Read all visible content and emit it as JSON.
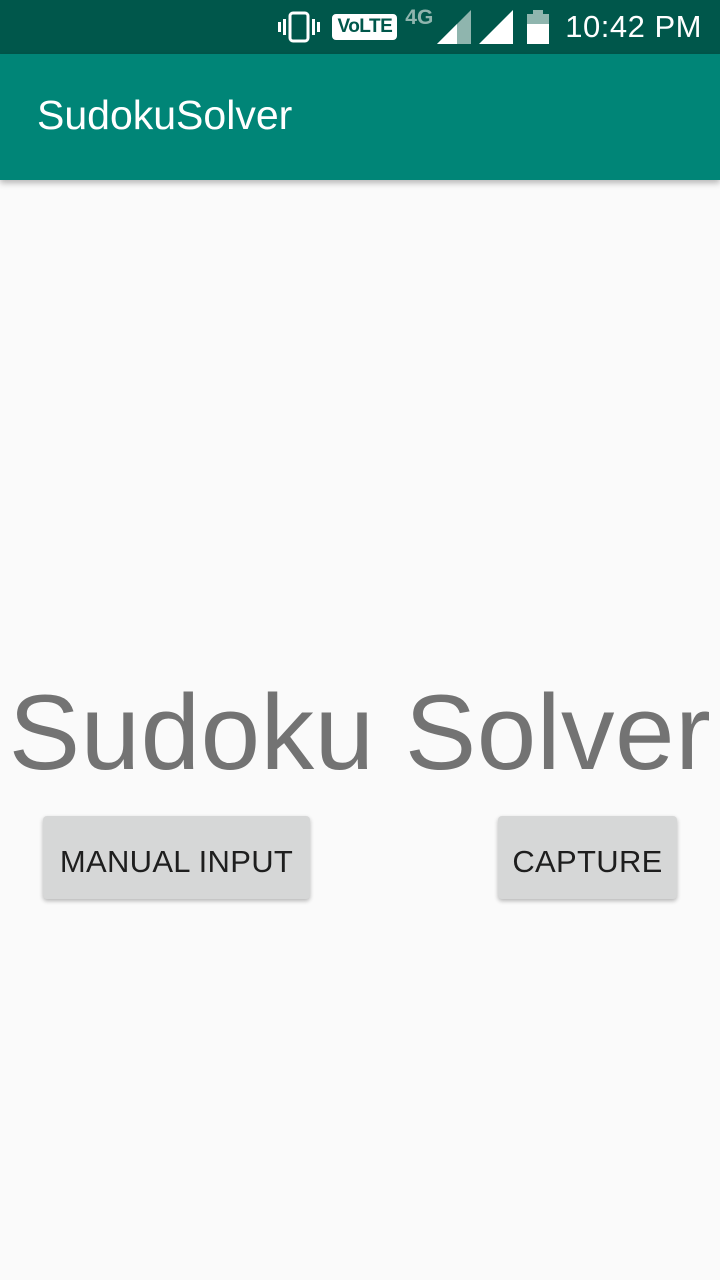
{
  "status_bar": {
    "icons": [
      "vibrate-icon",
      "volte-badge",
      "network-4g",
      "signal-icon",
      "signal-icon",
      "battery-icon"
    ],
    "volte_label": "VoLTE",
    "network_type": "4G",
    "time": "10:42 PM"
  },
  "app_bar": {
    "title": "SudokuSolver",
    "color": "#008577"
  },
  "main": {
    "headline": "Sudoku Solver",
    "manual_input_label": "MANUAL INPUT",
    "capture_label": "CAPTURE"
  },
  "colors": {
    "status_bar": "#00574b",
    "background": "#fafafa",
    "headline": "#737373",
    "button": "#d6d7d7"
  }
}
